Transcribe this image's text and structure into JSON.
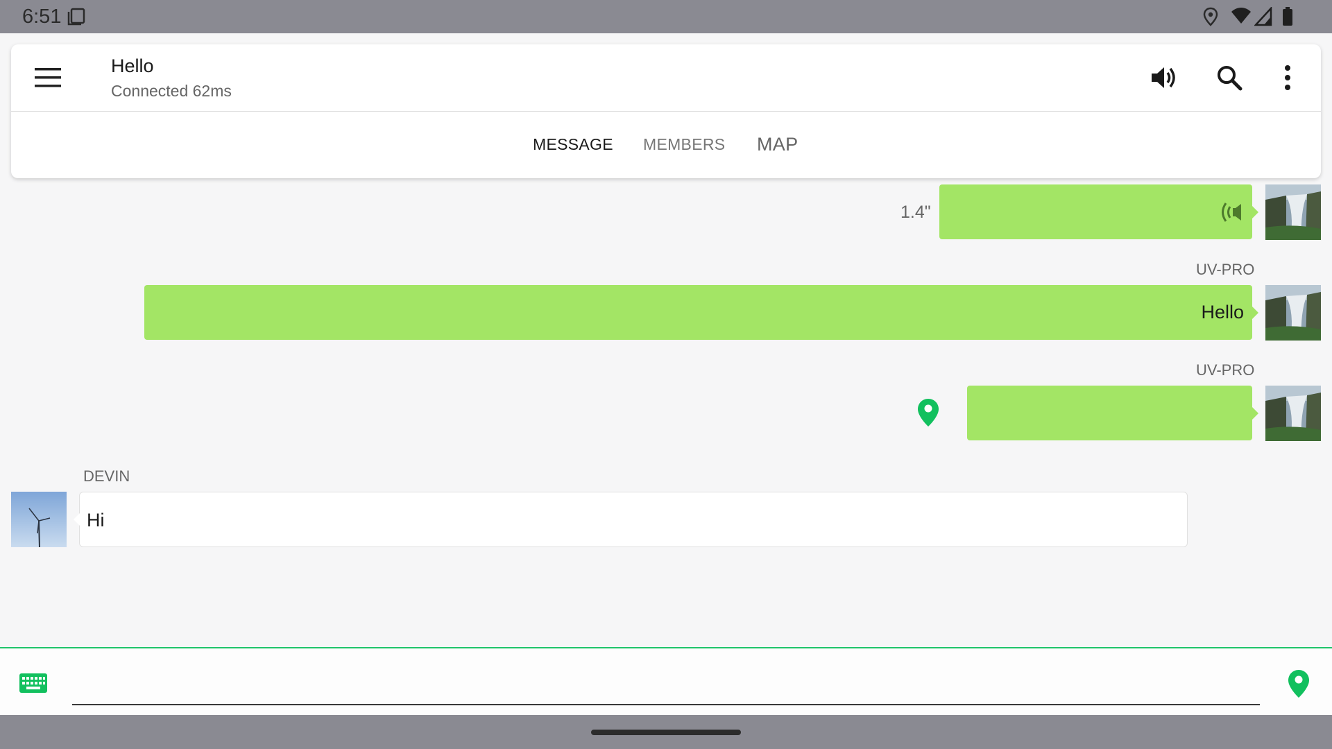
{
  "status_bar": {
    "time": "6:51",
    "icons": [
      "screenshot-icon",
      "location-icon",
      "wifi-icon",
      "signal-icon",
      "battery-icon"
    ]
  },
  "header": {
    "title": "Hello",
    "subtitle": "Connected 62ms",
    "actions": [
      "menu-icon",
      "volume-icon",
      "search-icon",
      "more-vert-icon"
    ]
  },
  "tabs": [
    {
      "label": "MESSAGE",
      "active": true
    },
    {
      "label": "MEMBERS",
      "active": false
    },
    {
      "label": "MAP",
      "active": false
    }
  ],
  "messages": [
    {
      "type": "voice",
      "outgoing": true,
      "duration": "1.4\"",
      "sender": ""
    },
    {
      "type": "text",
      "outgoing": true,
      "sender": "UV-PRO",
      "text": "Hello"
    },
    {
      "type": "location",
      "outgoing": true,
      "sender": "UV-PRO"
    },
    {
      "type": "text",
      "outgoing": false,
      "sender": "DEVIN",
      "text": "Hi"
    }
  ],
  "input": {
    "value": "",
    "left_icon": "keyboard-icon",
    "right_icon": "location-pin-icon"
  },
  "colors": {
    "accent": "#1ec46a",
    "outgoing_bubble": "#a3e565",
    "incoming_bubble": "#ffffff",
    "status_bar": "#8a8a92"
  }
}
